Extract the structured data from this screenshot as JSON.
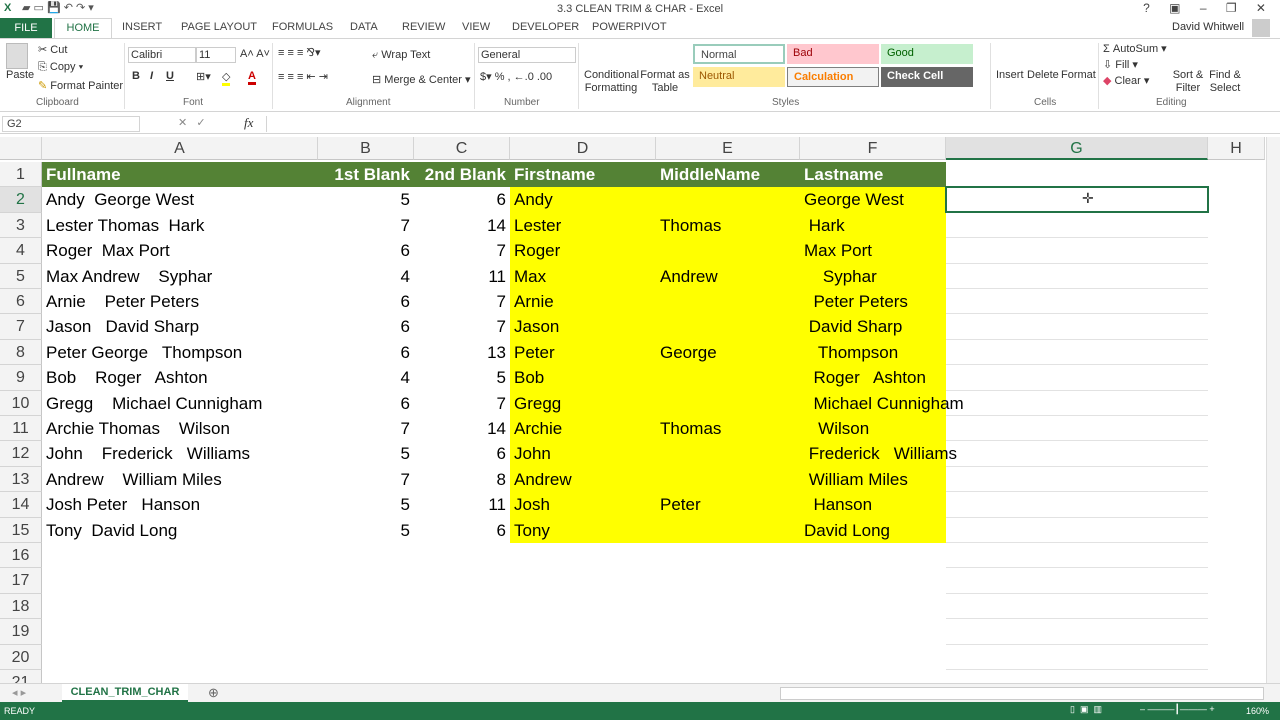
{
  "window": {
    "title": "3.3 CLEAN TRIM & CHAR - Excel",
    "user": "David Whitwell"
  },
  "tabs": [
    "FILE",
    "HOME",
    "INSERT",
    "PAGE LAYOUT",
    "FORMULAS",
    "DATA",
    "REVIEW",
    "VIEW",
    "DEVELOPER",
    "POWERPIVOT"
  ],
  "ribbon": {
    "clipboard": {
      "paste": "Paste",
      "cut": "Cut",
      "copy": "Copy",
      "format_painter": "Format Painter",
      "label": "Clipboard"
    },
    "font": {
      "name": "Calibri",
      "size": "11",
      "bold": "B",
      "italic": "I",
      "underline": "U",
      "label": "Font"
    },
    "alignment": {
      "wrap": "Wrap Text",
      "merge": "Merge & Center",
      "label": "Alignment"
    },
    "number": {
      "format": "General",
      "percent": "%",
      "comma": ",",
      "label": "Number"
    },
    "styles": {
      "conditional": "Conditional Formatting",
      "format_table": "Format as Table",
      "normal": "Normal",
      "bad": "Bad",
      "good": "Good",
      "neutral": "Neutral",
      "calculation": "Calculation",
      "check": "Check Cell",
      "label": "Styles"
    },
    "cells": {
      "insert": "Insert",
      "delete": "Delete",
      "format": "Format",
      "label": "Cells"
    },
    "editing": {
      "autosum": "AutoSum",
      "fill": "Fill",
      "clear": "Clear",
      "sort": "Sort & Filter",
      "find": "Find & Select",
      "label": "Editing"
    }
  },
  "formula_bar": {
    "name_box": "G2",
    "fx": "fx",
    "value": ""
  },
  "columns": [
    "A",
    "B",
    "C",
    "D",
    "E",
    "F",
    "G",
    "H"
  ],
  "rows": [
    "1",
    "2",
    "3",
    "4",
    "5",
    "6",
    "7",
    "8",
    "9",
    "10",
    "11",
    "12",
    "13",
    "14",
    "15",
    "16",
    "17",
    "18",
    "19",
    "20",
    "21"
  ],
  "headers": [
    "Fullname",
    "1st Blank",
    "2nd Blank",
    "Firstname",
    "MiddleName",
    "Lastname"
  ],
  "data": [
    [
      "Andy  George West",
      5,
      6,
      "Andy",
      "",
      "George West"
    ],
    [
      "Lester Thomas  Hark",
      7,
      14,
      "Lester",
      "Thomas",
      " Hark"
    ],
    [
      "Roger  Max Port",
      6,
      7,
      "Roger",
      "",
      "Max Port"
    ],
    [
      "Max Andrew    Syphar",
      4,
      11,
      "Max",
      "Andrew",
      "    Syphar"
    ],
    [
      "Arnie    Peter Peters",
      6,
      7,
      "Arnie",
      "",
      "  Peter Peters"
    ],
    [
      "Jason   David Sharp",
      6,
      7,
      "Jason",
      "",
      " David Sharp"
    ],
    [
      "Peter George   Thompson",
      6,
      13,
      "Peter",
      "George",
      "   Thompson"
    ],
    [
      "Bob    Roger   Ashton",
      4,
      5,
      "Bob",
      "",
      "  Roger   Ashton"
    ],
    [
      "Gregg    Michael Cunnigham",
      6,
      7,
      "Gregg",
      "",
      "  Michael Cunnigham"
    ],
    [
      "Archie Thomas    Wilson",
      7,
      14,
      "Archie",
      "Thomas",
      "   Wilson"
    ],
    [
      "John    Frederick   Williams",
      5,
      6,
      "John",
      "",
      " Frederick   Williams"
    ],
    [
      "Andrew    William Miles",
      7,
      8,
      "Andrew",
      "",
      " William Miles"
    ],
    [
      "Josh Peter   Hanson",
      5,
      11,
      "Josh",
      "Peter",
      "  Hanson"
    ],
    [
      "Tony  David Long",
      5,
      6,
      "Tony",
      "",
      "David Long"
    ]
  ],
  "sheet_tab": "CLEAN_TRIM_CHAR",
  "status": {
    "ready": "READY",
    "zoom": "160%"
  },
  "colors": {
    "accent": "#217346",
    "header_fill": "#548235",
    "highlight": "#ffff00"
  }
}
